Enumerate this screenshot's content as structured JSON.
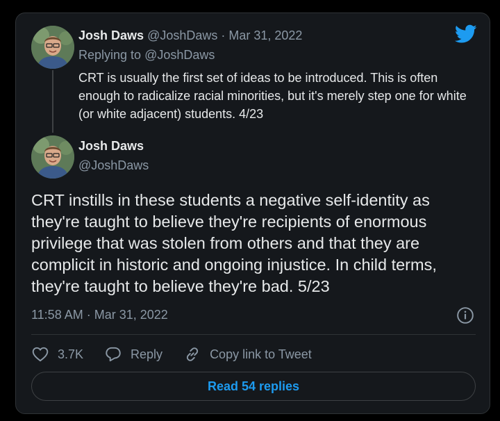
{
  "colors": {
    "background": "#000000",
    "card": "#15181c",
    "border": "#2f3336",
    "text": "#e7e9ea",
    "muted": "#8b98a5",
    "accent": "#1d9bf0"
  },
  "icons": {
    "logo": "twitter-bird-icon",
    "info": "info-icon",
    "like": "heart-icon",
    "reply": "speech-bubble-icon",
    "link": "link-icon"
  },
  "parent_tweet": {
    "author_name": "Josh Daws",
    "author_handle": "@JoshDaws",
    "separator": " · ",
    "date": "Mar 31, 2022",
    "replying_prefix": "Replying to ",
    "replying_to": "@JoshDaws",
    "text": "CRT is usually the first set of ideas to be introduced. This is often enough to radicalize racial minorities, but it's merely step one for white (or white adjacent) students. 4/23"
  },
  "main_tweet": {
    "author_name": "Josh Daws",
    "author_handle": "@JoshDaws",
    "text": "CRT instills in these students a negative self-identity as they're taught to believe they're recipients of enormous privilege that was stolen from others and that they are complicit in historic and ongoing injustice. In child terms, they're taught to believe they're bad. 5/23",
    "timestamp": "11:58 AM · Mar 31, 2022"
  },
  "actions": {
    "likes": "3.7K",
    "reply_label": "Reply",
    "copy_link_label": "Copy link to Tweet"
  },
  "footer": {
    "read_replies_label": "Read 54 replies"
  }
}
